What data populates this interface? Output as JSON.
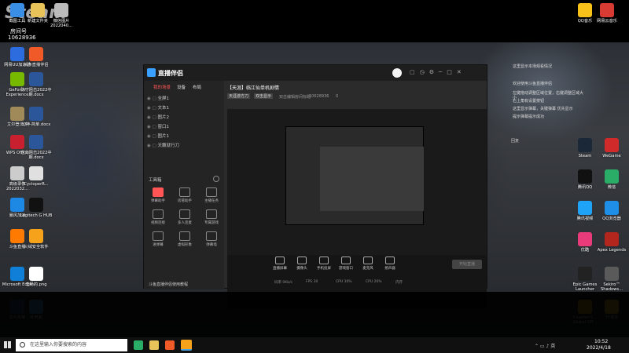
{
  "desktop": {
    "top_text": "Steam",
    "left_top_label": "房间号",
    "left_top_id": "10628936",
    "recycle_label": "回收站",
    "left_icons": [
      {
        "label": "网易UU加速器",
        "color": "#2d6cdf"
      },
      {
        "label": "头条直播伴侣",
        "color": "#f05a28"
      },
      {
        "label": "GeForce Experience",
        "color": "#76b900"
      },
      {
        "label": "防守阻击2022中期.docx",
        "color": "#2b579a"
      },
      {
        "label": "艾尔登法环",
        "color": "#a18a5a"
      },
      {
        "label": "幻神-简单.docx",
        "color": "#2b579a"
      },
      {
        "label": "WPS Office",
        "color": "#c8202f"
      },
      {
        "label": "逆向阻击2022中期.docx",
        "color": "#2b579a"
      },
      {
        "label": "高级录像2022032...",
        "color": "#cccccc"
      },
      {
        "label": "CycloperR...",
        "color": "#e0e0e0"
      },
      {
        "label": "暴风加速",
        "color": "#1e88e5"
      },
      {
        "label": "Logitech G HUB",
        "color": "#111111"
      },
      {
        "label": "斗鱼直播",
        "color": "#ff7a00"
      },
      {
        "label": "火绒安全软件",
        "color": "#f7a21b"
      },
      {
        "label": "Microsoft Edge",
        "color": "#0f7fd8"
      },
      {
        "label": "李畅的.png",
        "color": "#ffffff"
      },
      {
        "label": "华为先锋",
        "color": "#2b579a"
      },
      {
        "label": "此电脑",
        "color": "#4aa3df"
      }
    ],
    "top_icons": [
      {
        "label": "截图工具",
        "color": "#3a8ee6"
      },
      {
        "label": "新建文件夹",
        "color": "#e8c35a"
      },
      {
        "label": "微信图片2022040...",
        "color": "#cccccc"
      }
    ],
    "right_icons": [
      {
        "label": "QQ音乐",
        "color": "#f8c21b"
      },
      {
        "label": "网易云音乐",
        "color": "#d83a34"
      },
      {
        "label": "Steam",
        "color": "#1b2838"
      },
      {
        "label": "WeGame",
        "color": "#d02a2a"
      },
      {
        "label": "腾讯QQ",
        "color": "#111111"
      },
      {
        "label": "微信",
        "color": "#2aae67"
      },
      {
        "label": "腾讯视频",
        "color": "#1fa3f6"
      },
      {
        "label": "QQ浏览器",
        "color": "#1e8ee6"
      },
      {
        "label": "优酷",
        "color": "#e93a79"
      },
      {
        "label": "Apex Legends",
        "color": "#b3261e"
      },
      {
        "label": "Epic Games Launcher",
        "color": "#222222"
      },
      {
        "label": "Sekiro™ Shadows...",
        "color": "#5a5a5a"
      },
      {
        "label": "Counter-S... Global Off...",
        "color": "#d4a017"
      },
      {
        "label": "YY语音",
        "color": "#f3c42a"
      }
    ]
  },
  "chat": {
    "lines": [
      "这里显示本场观看情况",
      "欢迎使用斗鱼直播伴侣",
      "左键拖动调整区域位置，右键调整区域大小",
      "右上角有设置按钮",
      "这里显示弹幕，关键弹幕 优先显示",
      "提示弹幕提示成功"
    ],
    "footer": "回复"
  },
  "app": {
    "title": "直播伴侣",
    "sidebar_tabs": [
      "我的场景",
      "设备",
      "布局"
    ],
    "layers": [
      "全屏1",
      "文本1",
      "图片2",
      "窗口1",
      "图片1",
      "天籁就行刀"
    ],
    "tools_header": "工具箱",
    "tools": [
      "弹幕助手",
      "房管助手",
      "主播任务",
      "视频连接",
      "多人连麦",
      "专属游戏",
      "进弹幕",
      "虚拟形象",
      "弹幕墙"
    ],
    "footer": "斗鱼直播伴侣使用教程",
    "stream_title": "【天涯】临江仙单机剧情",
    "room_tag1": "天涯游方刀",
    "room_tag2": "双击显示",
    "room_hint": "双击编辑房间标题",
    "room_id": "10628936",
    "room_zero": "0",
    "bottom_btns": [
      "直播屏幕",
      "摄像头",
      "手机投屏",
      "游戏窗口",
      "麦克风",
      "扬声器"
    ],
    "start_label": "开始直播",
    "status": [
      "码率 0Kb/s",
      "FPS 30",
      "CPU 30%",
      "CPU 26%",
      "内存"
    ]
  },
  "taskbar": {
    "search_placeholder": "在这里输入你要搜索的内容",
    "time": "10:52",
    "date": "2022/4/18"
  }
}
